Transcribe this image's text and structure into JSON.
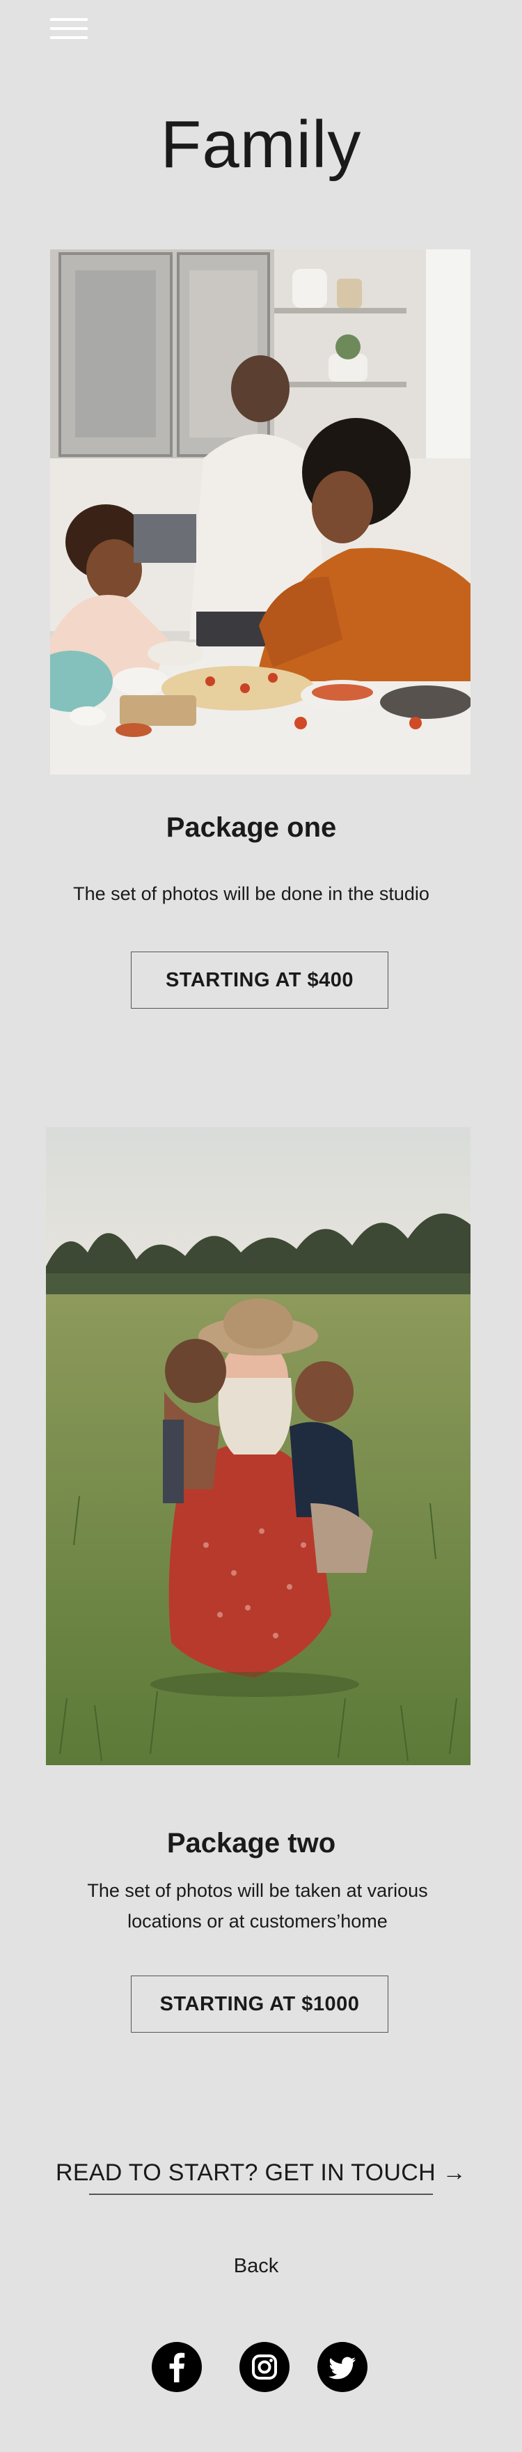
{
  "header": {
    "menu_icon": "hamburger-menu-icon",
    "menu_icon_color": "#ffffff"
  },
  "page": {
    "title": "Family",
    "background": "#e2e2e2"
  },
  "packages": [
    {
      "image": "family-kitchen-photo",
      "title": "Package one",
      "description": "The set of photos will be done in the studio",
      "button_label": "STARTING AT $400"
    },
    {
      "image": "mother-children-field-photo",
      "title": "Package two",
      "description": "The set of photos will be taken at various locations or at customers’home",
      "button_label": "STARTING AT $1000"
    }
  ],
  "cta": {
    "label": "READ TO START? GET IN TOUCH →"
  },
  "footer": {
    "back_label": "Back",
    "social": [
      {
        "icon": "facebook-icon"
      },
      {
        "icon": "instagram-icon"
      },
      {
        "icon": "twitter-icon"
      }
    ]
  }
}
